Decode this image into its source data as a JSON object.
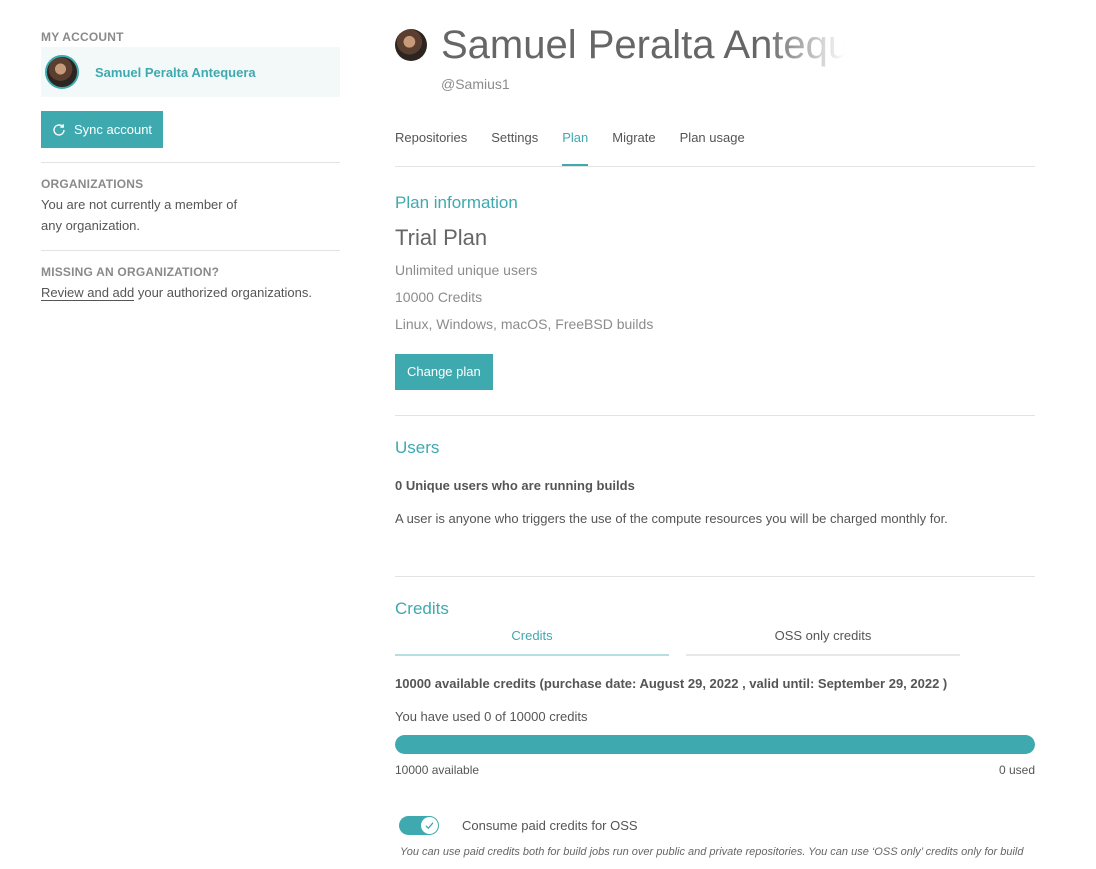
{
  "sidebar": {
    "my_account_heading": "MY ACCOUNT",
    "account_name": "Samuel Peralta Antequera",
    "sync_button_label": "Sync account",
    "organizations_heading": "ORGANIZATIONS",
    "organizations_text_line1": "You are not currently a member of",
    "organizations_text_line2": "any organization.",
    "missing_heading": "MISSING AN ORGANIZATION?",
    "review_link": "Review and add",
    "review_rest": " your authorized organizations."
  },
  "profile": {
    "name": "Samuel Peralta Antequera",
    "username": "@Samius1"
  },
  "tabs": [
    {
      "label": "Repositories",
      "active": false
    },
    {
      "label": "Settings",
      "active": false
    },
    {
      "label": "Plan",
      "active": true
    },
    {
      "label": "Migrate",
      "active": false
    },
    {
      "label": "Plan usage",
      "active": false
    }
  ],
  "plan": {
    "section_title": "Plan information",
    "name": "Trial Plan",
    "features": [
      "Unlimited unique users",
      "10000 Credits",
      "Linux, Windows, macOS, FreeBSD builds"
    ],
    "change_button": "Change plan"
  },
  "users": {
    "section_title": "Users",
    "count_text": "0 Unique users who are running builds",
    "description": "A user is anyone who triggers the use of the compute resources you will be charged monthly for."
  },
  "credits": {
    "section_title": "Credits",
    "tabs": [
      {
        "label": "Credits",
        "active": true
      },
      {
        "label": "OSS only credits",
        "active": false
      }
    ],
    "available_text": "10000 available credits (purchase date: August 29, 2022 , valid until: September 29, 2022 )",
    "used_text": "You have used 0 of 10000 credits",
    "available_fraction": 1.0,
    "available_label": "10000 available",
    "used_label": "0 used",
    "toggle_on": true,
    "toggle_label": "Consume paid credits for OSS",
    "toggle_note": "You can use paid credits both for build jobs run over public and private repositories. You can use ‘OSS only’ credits only for build"
  },
  "colors": {
    "accent": "#3ea9ae"
  },
  "icons": {
    "sync": "sync-icon",
    "check": "check-icon"
  }
}
